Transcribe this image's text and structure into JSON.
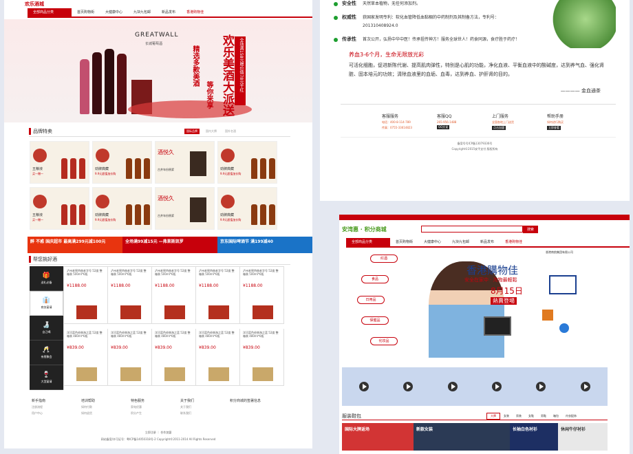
{
  "colors": {
    "brand_red": "#c7000b",
    "green": "#1d9e2f",
    "page_bg": "#e4e8f1"
  },
  "left_page": {
    "logo_text": "欢乐酒城",
    "nav": {
      "all_categories": "全部商品分类",
      "items": [
        "首页购物街",
        "大健康中心",
        "九块九包邮",
        "新品发布",
        "香港购物佳"
      ]
    },
    "banner": {
      "brand": "GREATWALL",
      "brand_cn": "长城葡萄酒",
      "vertical_1": "精选多款美酒",
      "vertical_2": "等你来享",
      "headline": "欢乐美酒大派送",
      "side_note": "全场满158元赠价值78元干红"
    },
    "brand_section": {
      "title": "品牌特卖",
      "tabs": [
        "国际品牌",
        "国内大牌",
        "国外名酒"
      ]
    },
    "brand_tiles": [
      {
        "name": "五粮液",
        "tag": "买一赠一",
        "icon": "wuliangye-logo-icon"
      },
      {
        "name": "劲牌典藏",
        "tag": "9.9元超值加价购",
        "icon": "jinpai-logo-icon"
      },
      {
        "name": "酒悦久",
        "tag": "古井年份原浆",
        "icon": "jiuyuejiu-logo-icon"
      },
      {
        "name": "劲牌典藏",
        "tag": "9.9元超值加价购",
        "icon": "jinpai-logo-icon"
      },
      {
        "name": "五粮液",
        "tag": "买一赠一",
        "icon": "wuliangye-logo-icon"
      },
      {
        "name": "劲牌典藏",
        "tag": "9.9元超值加价购",
        "icon": "jinpai-logo-icon"
      },
      {
        "name": "酒悦久",
        "tag": "古井年份原浆",
        "icon": "jiuyuejiu-logo-icon"
      },
      {
        "name": "劲牌典藏",
        "tag": "9.9元超值加价购",
        "icon": "jinpai-logo-icon"
      }
    ],
    "promos": [
      {
        "text": "醉 不惑 国庆超市 最高满299元减100元",
        "color": "#e8340f"
      },
      {
        "text": "全场满99减15元 —弗莱斯凯罗",
        "color": "#c7000b"
      },
      {
        "text": "京东国际啤酒节 满199减40",
        "color": "#1a73c7"
      }
    ],
    "pick_section": {
      "title": "帮您挑好酒",
      "categories": [
        {
          "label": "送礼必备",
          "icon": "gift-icon"
        },
        {
          "label": "商务宴请",
          "icon": "tie-icon"
        },
        {
          "label": "自己喝",
          "icon": "bottle-icon"
        },
        {
          "label": "亲朋聚会",
          "icon": "cheers-icon"
        },
        {
          "label": "大型宴请",
          "icon": "goblet-icon"
        }
      ]
    },
    "products": [
      {
        "name": "泸州老窖特曲老字号 52度 整箱装 500ml*6瓶",
        "price": "¥1188.00"
      },
      {
        "name": "泸州老窖特曲老字号 52度 整箱装 500ml*6瓶",
        "price": "¥1188.00"
      },
      {
        "name": "泸州老窖特曲老字号 52度 整箱装 500ml*6瓶",
        "price": "¥1188.00"
      },
      {
        "name": "泸州老窖特曲老字号 52度 整箱装 500ml*6瓶",
        "price": "¥1188.00"
      },
      {
        "name": "泸州老窖特曲老字号 52度 整箱装 500ml*6瓶",
        "price": "¥1188.00"
      },
      {
        "name": "洋河蓝色经典海之蓝 52度 整箱装 480ml*6瓶",
        "price": "¥839.00"
      },
      {
        "name": "洋河蓝色经典海之蓝 52度 整箱装 480ml*6瓶",
        "price": "¥839.00"
      },
      {
        "name": "洋河蓝色经典海之蓝 52度 整箱装 480ml*6瓶",
        "price": "¥839.00"
      },
      {
        "name": "洋河蓝色经典海之蓝 52度 整箱装 480ml*6瓶",
        "price": "¥839.00"
      },
      {
        "name": "洋河蓝色经典海之蓝 52度 整箱装 480ml*6瓶",
        "price": "¥839.00"
      }
    ],
    "footer": {
      "cols": [
        {
          "title": "新手指南",
          "items": [
            "注册流程",
            "用户中心"
          ]
        },
        {
          "title": "培训帮助",
          "items": [
            "如何付款",
            "如何退货"
          ]
        },
        {
          "title": "特色服务",
          "items": [
            "家电优惠",
            "积分产生"
          ]
        },
        {
          "title": "关于我们",
          "items": [
            "关于我们",
            "联系我们"
          ]
        }
      ],
      "mall_title": "积分商城的签署信息",
      "links": "立即注册 ｜ 合作加盟",
      "copyright": "网站备案/许可证号：粤ICP备14050318号-2 Copyright©2011-2014 All Rights Reserved"
    }
  },
  "right_top": {
    "features": [
      {
        "key": "安全性",
        "value": "天然草本植物，无任何添加剂。"
      },
      {
        "key": "权威性",
        "value": "获国家发明专利：软化血管降低血黏稠的中药制剂及其制备方法，专利号：201310408924.0"
      },
      {
        "key": "传承性",
        "value": "首次公开，弘扬中华中医！传承祖传神方！服务全球世人！药食同源，食疗胜于药疗！"
      }
    ],
    "subtitle": "养血3-6个月，生命无限放光彩",
    "paragraph": "可活化细胞，促进新陈代谢、提高肌肉弹性，特别是心肌的功能，净化血液、平衡血液中的酸碱度，达到养气血、强化肾脏、固本培元的功效；清除血液里的血垢、血毒，达到养血、护肝肾的目的。",
    "signature": "———— 金血通茶",
    "services": [
      {
        "title": "客服服务",
        "line1": "电话：400-8-114-789",
        "line2": "传真：0755-33614823",
        "badge": ""
      },
      {
        "title": "客服QQ",
        "line1": "265-956-1488",
        "line2": "",
        "badge": "QQ交谈"
      },
      {
        "title": "上门服务",
        "line1": "全国各地上门送货",
        "line2": "",
        "badge": "点击加盟"
      },
      {
        "title": "帮助手册",
        "line1": "如何进行购买",
        "line2": "",
        "badge": "立即查看"
      }
    ],
    "icp": "备案号号ICP备13079336号",
    "copy": "Copyright©2015安平支付 版权所有"
  },
  "right_bottom": {
    "logo_text": "安湾惠 · 积分商城",
    "search_button": "搜索",
    "nav": {
      "all_categories": "全部商品分类",
      "items": [
        "首页购物街",
        "大健康中心",
        "九块九包邮",
        "新品发布",
        "香港购物佳"
      ]
    },
    "bubbles": [
      "红酒",
      "食品",
      "日用品",
      "保健品",
      "化妆品"
    ],
    "hero": {
      "title": "香港購物佳",
      "sub": "安全在家中 · 淘物最輕鬆",
      "date": "8月15日",
      "tag": "熱賣登場",
      "company": "香港南航集团有限公司"
    },
    "clothing": {
      "title": "服装鞋包",
      "tabs": [
        "大牌",
        "女装",
        "男装",
        "女鞋",
        "男鞋",
        "箱包",
        "内衣配饰"
      ],
      "tiles": [
        "国际大牌返场",
        "新款女装",
        "长袖白色衬衫",
        "休闲牛仔衬衫"
      ]
    }
  }
}
